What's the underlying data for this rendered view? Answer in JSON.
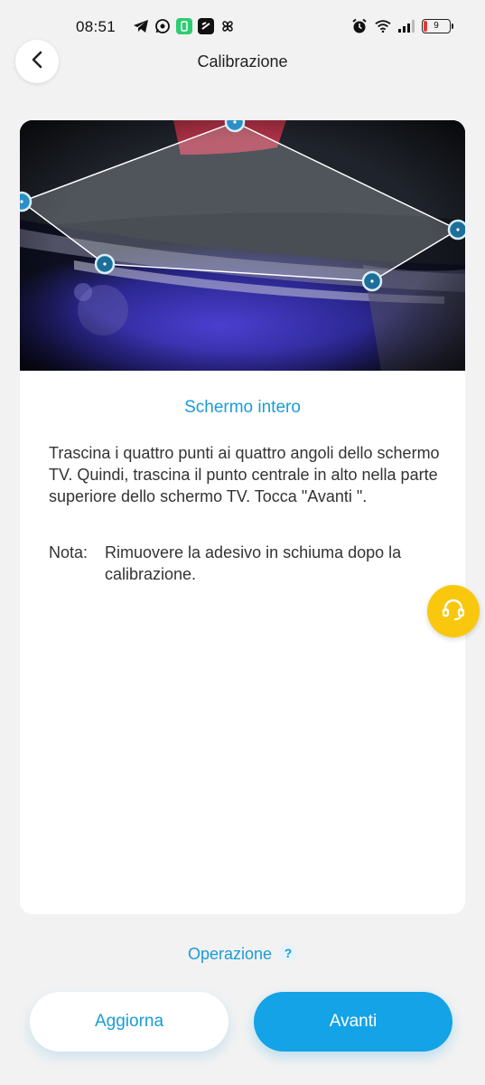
{
  "status_bar": {
    "time": "08:51",
    "battery_level": "9",
    "icons": [
      "telegram-icon",
      "whatsapp-icon",
      "green-app-icon",
      "notes-app-icon",
      "pinwheel-icon",
      "alarm-icon",
      "wifi-icon",
      "signal-icon",
      "battery-icon"
    ]
  },
  "header": {
    "title": "Calibrazione"
  },
  "calibration": {
    "mode_title": "Schermo intero",
    "instructions": "Trascina i quattro punti ai quattro angoli dello schermo TV. Quindi, trascina il punto centrale in alto nella parte superiore dello schermo TV. Tocca \"Avanti \".",
    "note_label": "Nota:",
    "note_text": "Rimuovere la adesivo in schiuma dopo la calibrazione."
  },
  "footer": {
    "operation_link": "Operazione",
    "help_symbol": "?",
    "refresh_button": "Aggiorna",
    "next_button": "Avanti"
  },
  "colors": {
    "accent": "#1a9bd7",
    "primary_button": "#13a3e6",
    "support_button": "#f9c80e",
    "background": "#f2f2f2"
  }
}
